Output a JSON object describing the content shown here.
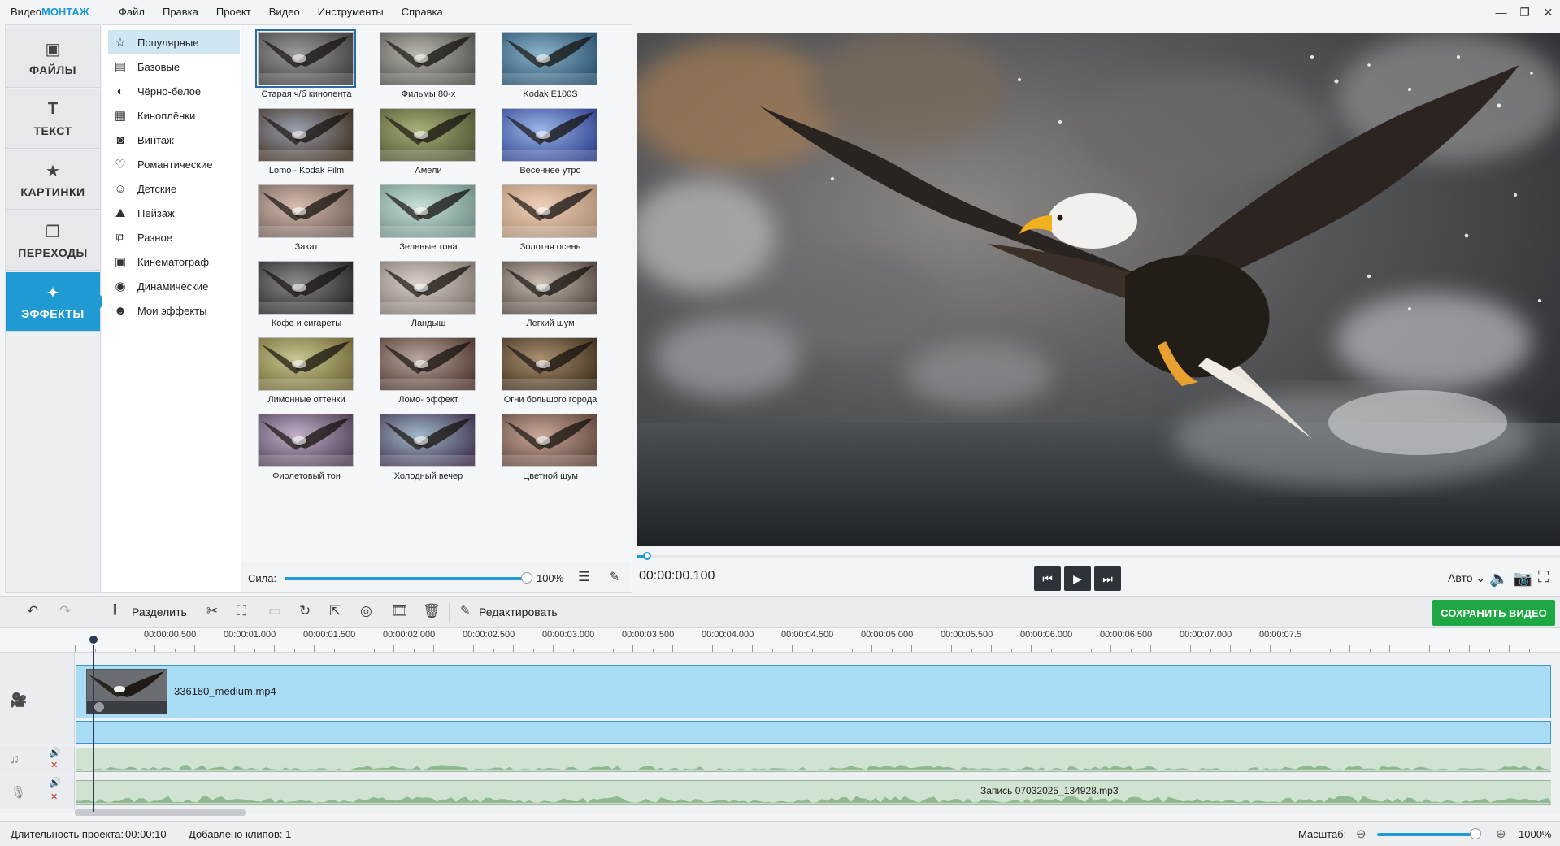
{
  "app": {
    "brand_part1": "Видео",
    "brand_part2": "МОНТАЖ"
  },
  "menu": [
    "Файл",
    "Правка",
    "Проект",
    "Видео",
    "Инструменты",
    "Справка"
  ],
  "window_controls": {
    "minimize": "—",
    "restore": "❐",
    "close": "✕"
  },
  "left_tabs": [
    {
      "label": "ФАЙЛЫ",
      "icon": "image-icon",
      "glyph": "▣"
    },
    {
      "label": "ТЕКСТ",
      "icon": "text-icon",
      "glyph": "T"
    },
    {
      "label": "КАРТИНКИ",
      "icon": "star-icon",
      "glyph": "★"
    },
    {
      "label": "ПЕРЕХОДЫ",
      "icon": "transitions-icon",
      "glyph": "❐"
    },
    {
      "label": "ЭФФЕКТЫ",
      "icon": "magic-wand-icon",
      "glyph": "✦"
    }
  ],
  "categories": [
    {
      "label": "Популярные",
      "glyph": "☆"
    },
    {
      "label": "Базовые",
      "glyph": "▤"
    },
    {
      "label": "Чёрно-белое",
      "glyph": "◐"
    },
    {
      "label": "Киноплёнки",
      "glyph": "▦"
    },
    {
      "label": "Винтаж",
      "glyph": "◙"
    },
    {
      "label": "Романтические",
      "glyph": "♡"
    },
    {
      "label": "Детские",
      "glyph": "☺"
    },
    {
      "label": "Пейзаж",
      "glyph": "⛰"
    },
    {
      "label": "Разное",
      "glyph": "⧉"
    },
    {
      "label": "Кинематограф",
      "glyph": "▣"
    },
    {
      "label": "Динамические",
      "glyph": "◉"
    },
    {
      "label": "Мои эффекты",
      "glyph": "☻"
    }
  ],
  "effects": [
    {
      "name": "Старая ч/б кинолента",
      "c1": "#9a9a9a",
      "c2": "#3a3a3a"
    },
    {
      "name": "Фильмы 80-х",
      "c1": "#b8b8b0",
      "c2": "#4a4a46"
    },
    {
      "name": "Kodak E100S",
      "c1": "#8ab4c8",
      "c2": "#244a6a"
    },
    {
      "name": "Lomo - Kodak Film",
      "c1": "#9aa0b0",
      "c2": "#3a2a1a"
    },
    {
      "name": "Амели",
      "c1": "#a8b078",
      "c2": "#4a5030"
    },
    {
      "name": "Весеннее утро",
      "c1": "#9ab8e8",
      "c2": "#2a3a8a"
    },
    {
      "name": "Закат",
      "c1": "#d8bcb0",
      "c2": "#6a5a52"
    },
    {
      "name": "Зеленые тона",
      "c1": "#c8e0d8",
      "c2": "#6a8a80"
    },
    {
      "name": "Золотая осень",
      "c1": "#f0d0b8",
      "c2": "#a88a70"
    },
    {
      "name": "Кофе и сигареты",
      "c1": "#8a8a8a",
      "c2": "#202020"
    },
    {
      "name": "Ландыш",
      "c1": "#d8d0c8",
      "c2": "#7a7068"
    },
    {
      "name": "Легкий шум",
      "c1": "#c8bcb0",
      "c2": "#4a4038"
    },
    {
      "name": "Лимонные оттенки",
      "c1": "#c8c890",
      "c2": "#6a6030"
    },
    {
      "name": "Ломо- эффект",
      "c1": "#b8a8a0",
      "c2": "#4a3028"
    },
    {
      "name": "Огни большого города",
      "c1": "#a89070",
      "c2": "#3a2a18"
    },
    {
      "name": "Фиолетовый тон",
      "c1": "#c0b0c8",
      "c2": "#4a3a50"
    },
    {
      "name": "Холодный вечер",
      "c1": "#a0b8c8",
      "c2": "#3a2a48"
    },
    {
      "name": "Цветной шум",
      "c1": "#c8a898",
      "c2": "#5a4038"
    }
  ],
  "strength": {
    "label": "Сила:",
    "value_text": "100%",
    "value": 1.0
  },
  "player": {
    "timecode": "00:00:00.100",
    "quality": "Авто ⌄",
    "position": 0.01,
    "buttons": {
      "prev": "⏮",
      "play": "▶",
      "next": "⏭"
    },
    "icons": {
      "volume": "🔈",
      "snapshot": "📷",
      "fullscreen": "⛶"
    }
  },
  "toolbar": {
    "undo": "↶",
    "redo": "↷",
    "split_label": "Разделить",
    "edit_label": "Редактировать",
    "save_label": "СОХРАНИТЬ ВИДЕО",
    "tools": [
      "✂",
      "⛶",
      "▭",
      "↻",
      "⇱",
      "◎",
      "🎞",
      "🗑"
    ]
  },
  "ruler": [
    "00:00:00.500",
    "00:00:01.000",
    "00:00:01.500",
    "00:00:02.000",
    "00:00:02.500",
    "00:00:03.000",
    "00:00:03.500",
    "00:00:04.000",
    "00:00:04.500",
    "00:00:05.000",
    "00:00:05.500",
    "00:00:06.000",
    "00:00:06.500",
    "00:00:07.000",
    "00:00:07.5"
  ],
  "timeline": {
    "video_clip": "336180_medium.mp4",
    "audio_clip": "Запись 07032025_134928.mp3",
    "track_icons": {
      "video": "🎥",
      "music": "♫",
      "mic": "🎙",
      "speaker": "🔊",
      "mute": "✕"
    }
  },
  "status": {
    "duration_label": "Длительность проекта:",
    "duration_value": "00:00:10",
    "clips_label": "Добавлено клипов: 1",
    "zoom_label": "Масштаб:",
    "zoom_value": "1000%",
    "zoom_minus": "⊖",
    "zoom_plus": "⊕"
  },
  "colors": {
    "accent": "#1f9ad3",
    "save": "#1fa744"
  }
}
